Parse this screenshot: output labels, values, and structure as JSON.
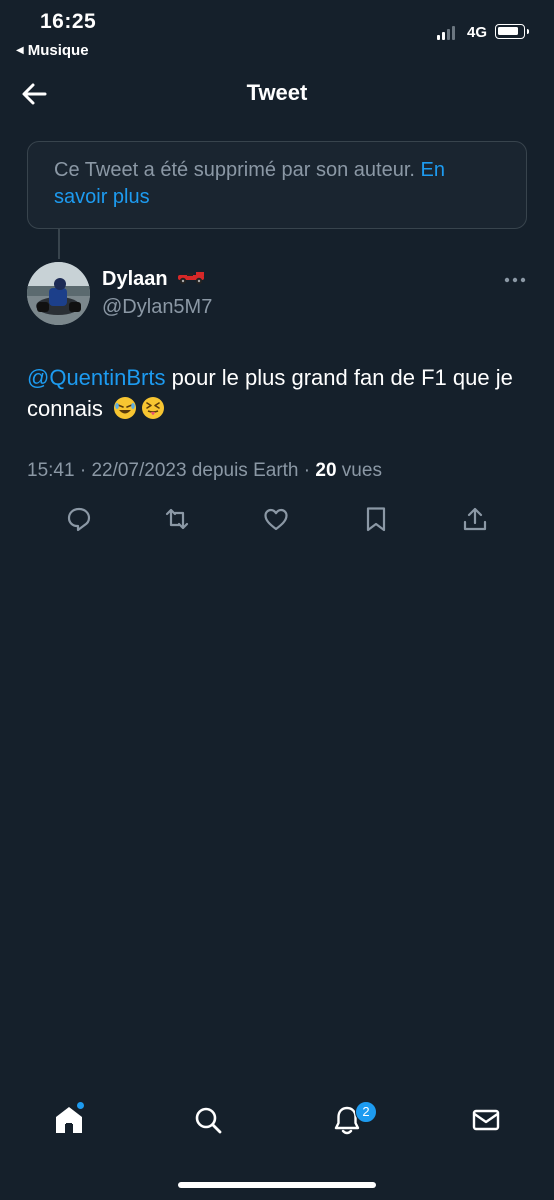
{
  "status_bar": {
    "time": "16:25",
    "back_app": "Musique",
    "back_glyph": "◀",
    "network": "4G"
  },
  "header": {
    "title": "Tweet",
    "back_icon": "arrow-left-icon"
  },
  "deleted_notice": {
    "text": "Ce Tweet a été supprimé par son auteur. ",
    "link": "En savoir plus"
  },
  "author": {
    "name": "Dylaan",
    "name_emoji": "race-car-icon",
    "handle": "@Dylan5M7"
  },
  "tweet": {
    "mention": "@QuentinBrts",
    "text": " pour le plus grand fan de F1 que je connais",
    "emojis": [
      "rolling-on-floor-laughing-icon",
      "squinting-tongue-icon"
    ]
  },
  "meta": {
    "time": "15:41",
    "sep1": " · ",
    "date": "22/07/2023 depuis Earth",
    "sep2": " · ",
    "views_count": "20",
    "views_label": " vues"
  },
  "actions": [
    "reply-icon",
    "retweet-icon",
    "like-icon",
    "bookmark-icon",
    "share-icon"
  ],
  "tab_bar": {
    "items": [
      "home-icon",
      "search-icon",
      "notifications-icon",
      "messages-icon"
    ],
    "notifications_badge": "2"
  },
  "colors": {
    "background": "#15202b",
    "accent": "#1d9bf0",
    "secondary_text": "#8b98a5",
    "border": "#38444d"
  }
}
